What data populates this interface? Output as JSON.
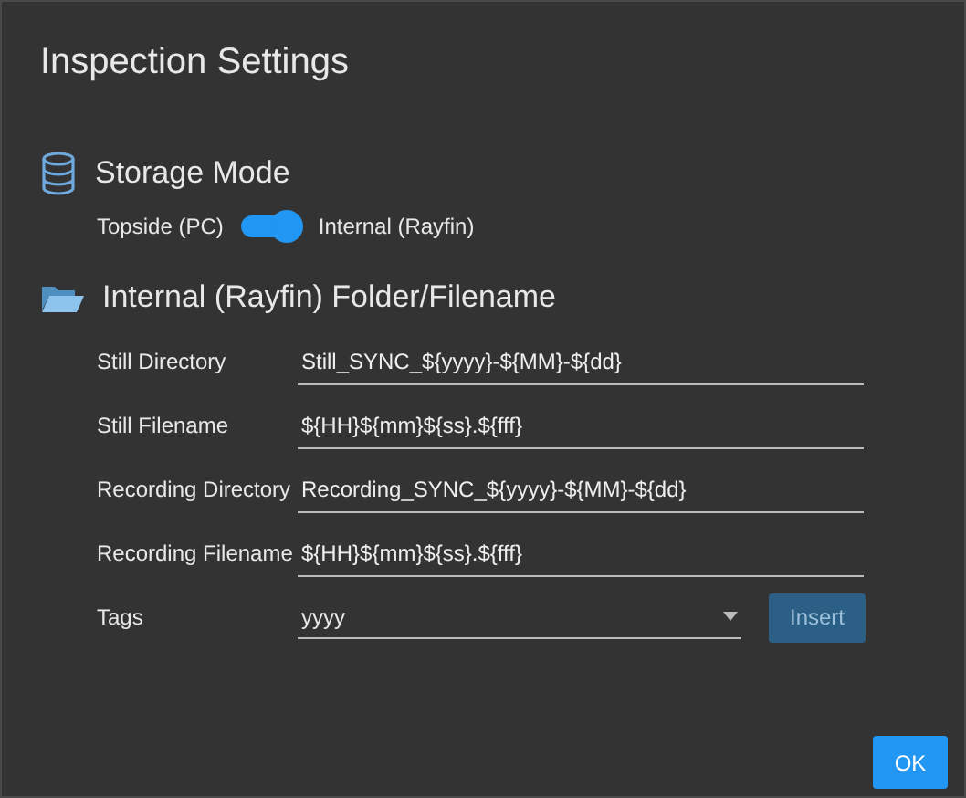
{
  "dialog": {
    "title": "Inspection Settings"
  },
  "storage": {
    "heading": "Storage Mode",
    "off_label": "Topside (PC)",
    "on_label": "Internal (Rayfin)",
    "on": true
  },
  "folder": {
    "heading": "Internal (Rayfin) Folder/Filename",
    "fields": [
      {
        "label": "Still Directory",
        "value": "Still_SYNC_${yyyy}-${MM}-${dd}"
      },
      {
        "label": "Still Filename",
        "value": "${HH}${mm}${ss}.${fff}"
      },
      {
        "label": "Recording Directory",
        "value": "Recording_SYNC_${yyyy}-${MM}-${dd}"
      },
      {
        "label": "Recording Filename",
        "value": "${HH}${mm}${ss}.${fff}"
      }
    ],
    "tags": {
      "label": "Tags",
      "value": "yyyy",
      "button": "Insert",
      "button_disabled": true
    }
  },
  "buttons": [
    {
      "label": "OK"
    }
  ]
}
